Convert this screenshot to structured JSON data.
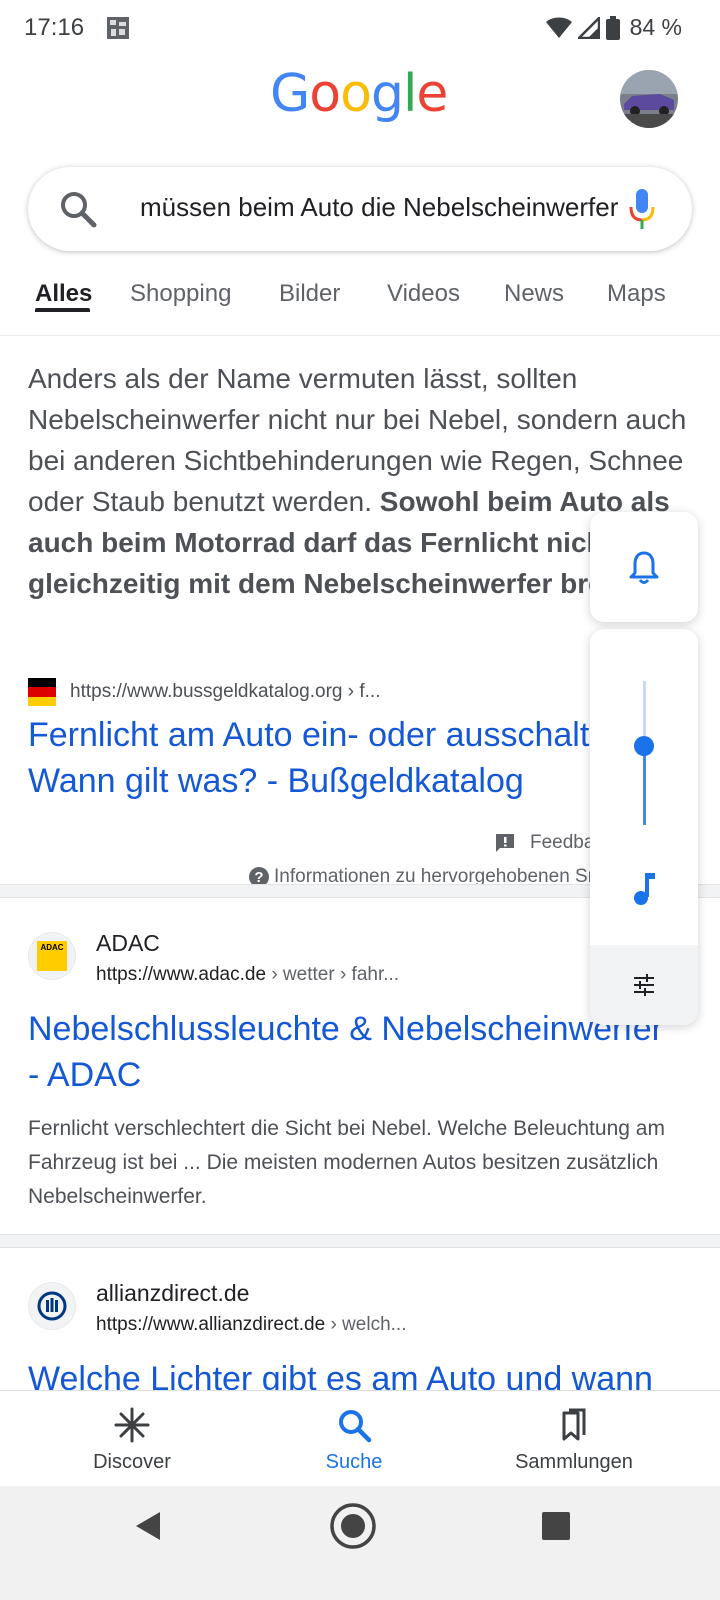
{
  "status_bar": {
    "time": "17:16",
    "battery": "84 %"
  },
  "header": {
    "logo_letters": [
      {
        "char": "G",
        "color": "#4285F4"
      },
      {
        "char": "o",
        "color": "#EA4335"
      },
      {
        "char": "o",
        "color": "#FBBC05"
      },
      {
        "char": "g",
        "color": "#4285F4"
      },
      {
        "char": "l",
        "color": "#34A853"
      },
      {
        "char": "e",
        "color": "#EA4335"
      }
    ],
    "avatar_icon": "profile-avatar"
  },
  "search": {
    "query": "müssen beim Auto die Nebelscheinwerfer",
    "icons": [
      "search-icon",
      "mic-icon"
    ]
  },
  "tabs": [
    {
      "label": "Alles",
      "active": true
    },
    {
      "label": "Shopping",
      "active": false
    },
    {
      "label": "Bilder",
      "active": false
    },
    {
      "label": "Videos",
      "active": false
    },
    {
      "label": "News",
      "active": false
    },
    {
      "label": "Maps",
      "active": false
    }
  ],
  "featured_snippet": {
    "text_plain": "Anders als der Name vermuten lässt, sollten Nebelscheinwerfer nicht nur bei Nebel, sondern auch bei anderen Sichtbehinderungen wie Regen, Schnee oder Staub benutzt werden. ",
    "text_bold": "Sowohl beim Auto als auch beim Motorrad darf das Fernlicht nicht gleichzeitig mit dem Nebelscheinwerfer brennen",
    "text_end": ".",
    "source_url": "https://www.bussgeldkatalog.org › f...",
    "title_line1": "Fernlicht am Auto ein- oder ausschalten:",
    "title_line2": "Wann gilt was? - Bußgeldkatalog",
    "feedback_label": "Feedback",
    "info_label": "Informationen zu hervorgehobenen Snippets"
  },
  "results": [
    {
      "site_name": "ADAC",
      "url_base": "https://www.adac.de",
      "url_crumbs": " › wetter › fahr...",
      "favicon_text": "ADAC",
      "title_line1": "Nebelschlussleuchte & Nebelscheinwerfer",
      "title_line2": "- ADAC",
      "description": "Fernlicht verschlechtert die Sicht bei Nebel. Welche Beleuchtung am Fahrzeug ist bei ... Die meisten modernen Autos besitzen zusätzlich Nebelscheinwerfer."
    },
    {
      "site_name": "allianzdirect.de",
      "url_base": "https://www.allianzdirect.de",
      "url_crumbs": " › welch...",
      "title_line1": "Welche Lichter gibt es am Auto und wann"
    }
  ],
  "volume_panel": {
    "level_fraction": 0.55,
    "icons": [
      "bell-icon",
      "music-note-icon",
      "equalizer-settings-icon"
    ],
    "accent": "#1a73e8"
  },
  "bottom_nav": [
    {
      "label": "Discover",
      "icon": "asterisk-icon",
      "active": false
    },
    {
      "label": "Suche",
      "icon": "search-icon",
      "active": true
    },
    {
      "label": "Sammlungen",
      "icon": "collections-icon",
      "active": false
    }
  ],
  "colors": {
    "link_blue": "#1558d6",
    "accent_blue": "#1a73e8"
  }
}
